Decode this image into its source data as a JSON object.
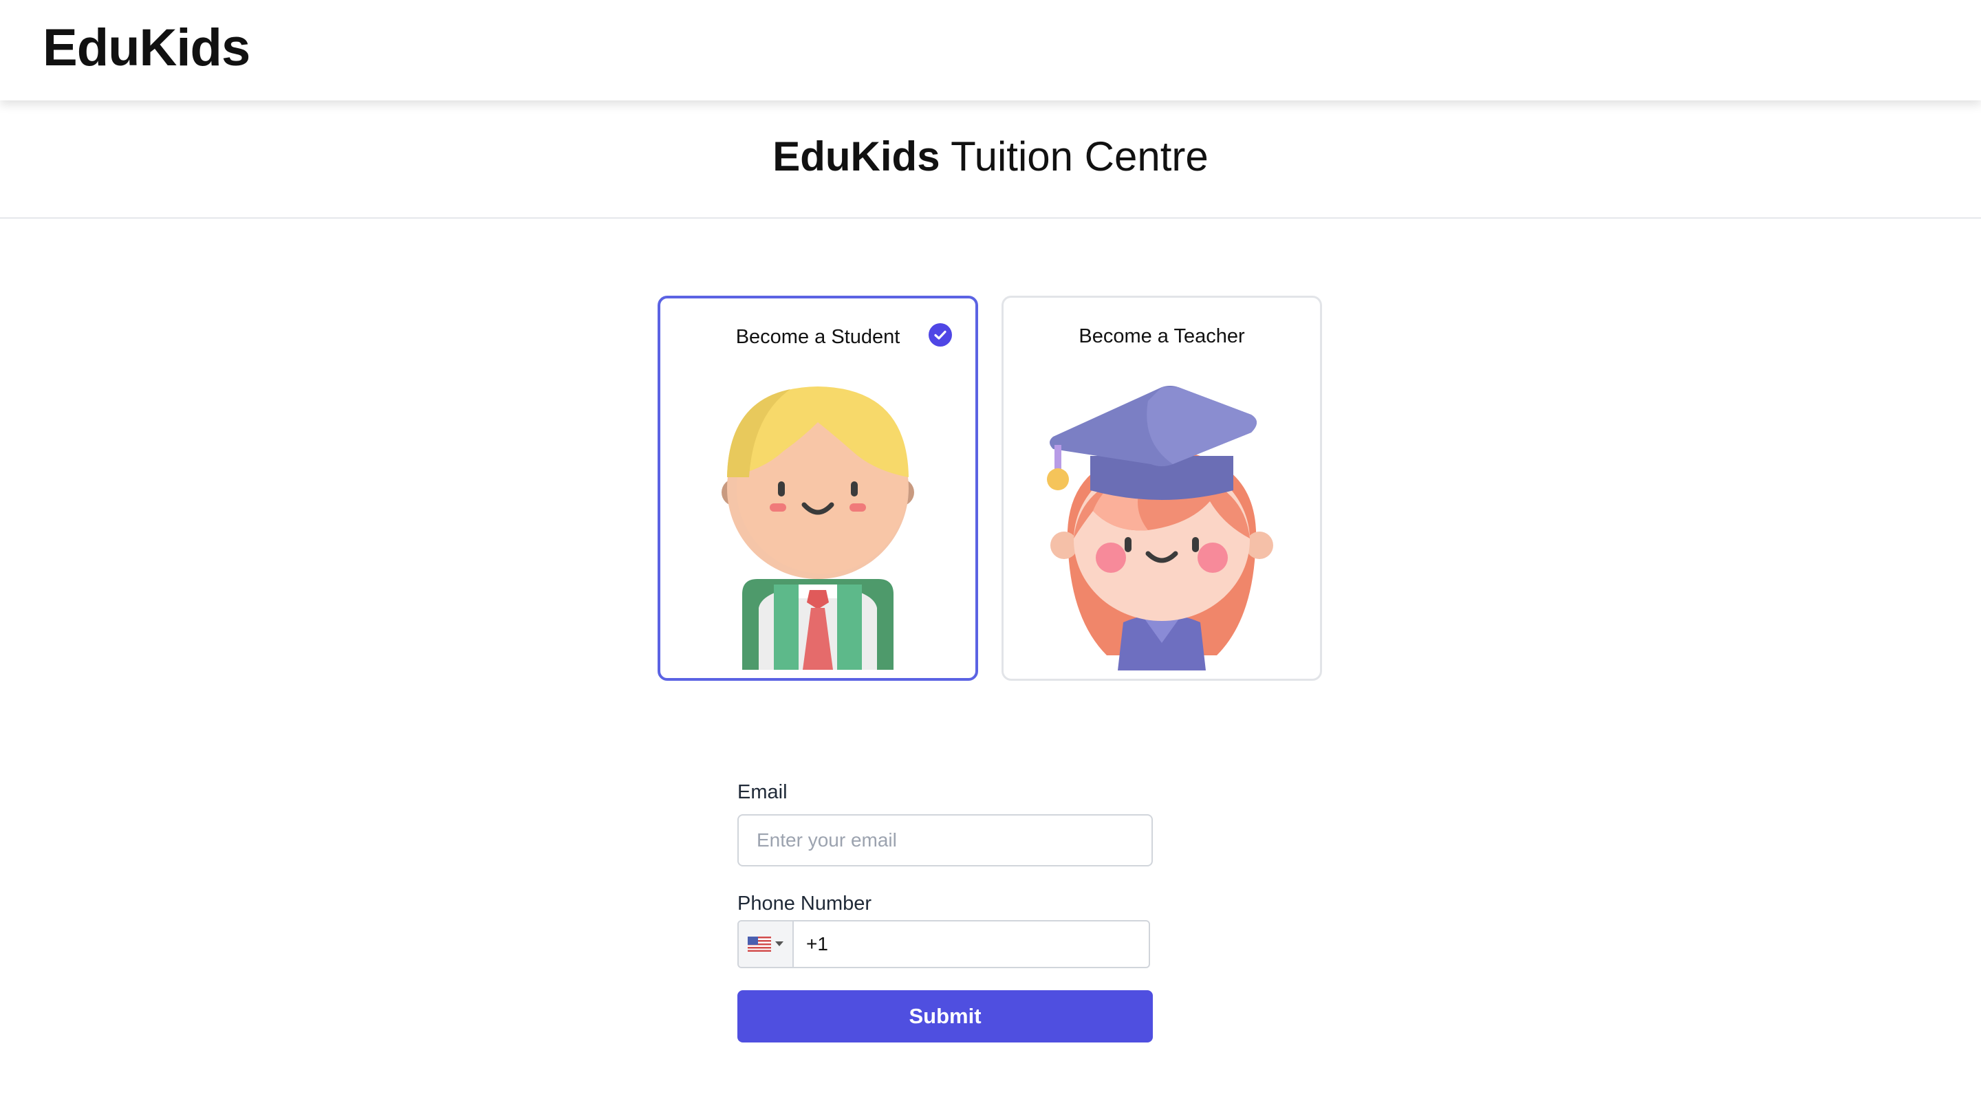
{
  "header": {
    "logo": "EduKids"
  },
  "hero": {
    "brand": "EduKids",
    "rest": " Tuition Centre"
  },
  "roles": {
    "student": {
      "label": "Become a Student",
      "selected": true
    },
    "teacher": {
      "label": "Become a Teacher",
      "selected": false
    }
  },
  "form": {
    "email": {
      "label": "Email",
      "placeholder": "Enter your email",
      "value": ""
    },
    "phone": {
      "label": "Phone Number",
      "country": "us-flag-icon",
      "value": "+1"
    },
    "submit_label": "Submit"
  },
  "colors": {
    "accent": "#4f46e5",
    "selected_border": "#5b63e3",
    "submit_bg": "#4f4fe0"
  }
}
